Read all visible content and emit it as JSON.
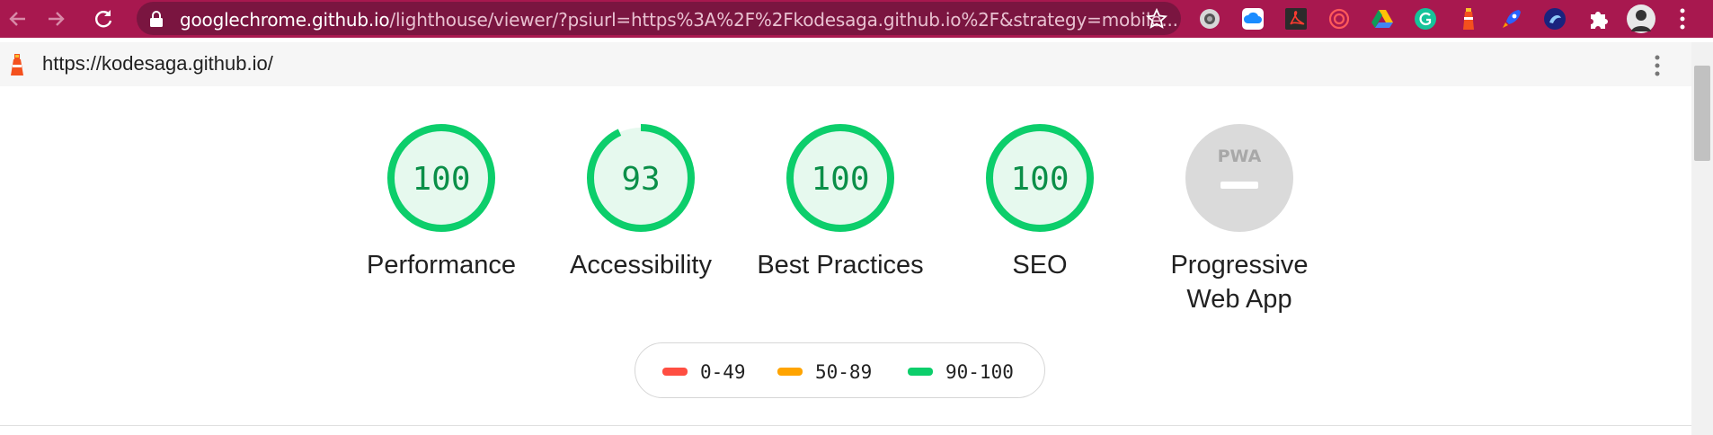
{
  "browser": {
    "url_host": "googlechrome.github.io",
    "url_path": "/lighthouse/viewer/?psiurl=https%3A%2F%2Fkodesaga.github.io%2F&strategy=mobile...",
    "extensions": [
      "camera-extension-icon",
      "cloud-extension-icon",
      "pdf-extension-icon",
      "spiral-extension-icon",
      "drive-extension-icon",
      "grammarly-extension-icon",
      "lighthouse-extension-icon",
      "rocket-extension-icon",
      "bird-extension-icon",
      "puzzle-extension-icon"
    ]
  },
  "report": {
    "url": "https://kodesaga.github.io/"
  },
  "gauges": [
    {
      "label": "Performance",
      "value": "100",
      "score": 1.0
    },
    {
      "label": "Accessibility",
      "value": "93",
      "score": 0.93
    },
    {
      "label": "Best Practices",
      "value": "100",
      "score": 1.0
    },
    {
      "label": "SEO",
      "value": "100",
      "score": 1.0
    }
  ],
  "pwa": {
    "label_line1": "Progressive",
    "label_line2": "Web App",
    "badge_text": "PWA"
  },
  "legend": [
    {
      "text": "0-49",
      "color": "#ff4e42"
    },
    {
      "text": "50-89",
      "color": "#ffa400"
    },
    {
      "text": "90-100",
      "color": "#0cce6b"
    }
  ],
  "colors": {
    "pass": "#0cce6b",
    "pass_fill": "#e6f9ee",
    "toolbar": "#a8184f"
  }
}
